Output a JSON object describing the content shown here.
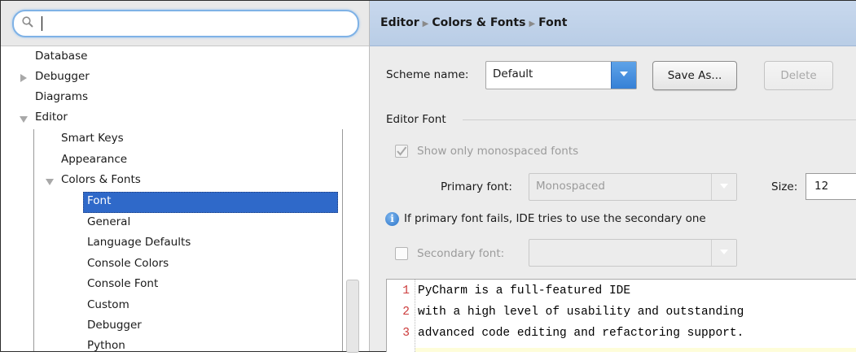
{
  "search": {
    "placeholder": "",
    "value": ""
  },
  "tree": {
    "items": [
      {
        "label": "Database",
        "level": 0,
        "expander": "none"
      },
      {
        "label": "Debugger",
        "level": 0,
        "expander": "collapsed"
      },
      {
        "label": "Diagrams",
        "level": 0,
        "expander": "none"
      },
      {
        "label": "Editor",
        "level": 0,
        "expander": "expanded"
      },
      {
        "label": "Smart Keys",
        "level": 1,
        "expander": "none"
      },
      {
        "label": "Appearance",
        "level": 1,
        "expander": "none"
      },
      {
        "label": "Colors & Fonts",
        "level": 1,
        "expander": "expanded"
      },
      {
        "label": "Font",
        "level": 2,
        "expander": "none",
        "selected": true
      },
      {
        "label": "General",
        "level": 2,
        "expander": "none"
      },
      {
        "label": "Language Defaults",
        "level": 2,
        "expander": "none"
      },
      {
        "label": "Console Colors",
        "level": 2,
        "expander": "none"
      },
      {
        "label": "Console Font",
        "level": 2,
        "expander": "none"
      },
      {
        "label": "Custom",
        "level": 2,
        "expander": "none"
      },
      {
        "label": "Debugger",
        "level": 2,
        "expander": "none"
      },
      {
        "label": "Python",
        "level": 2,
        "expander": "none"
      }
    ]
  },
  "breadcrumb": {
    "parts": [
      "Editor",
      "Colors & Fonts",
      "Font"
    ]
  },
  "scheme": {
    "label": "Scheme name:",
    "value": "Default",
    "save_as": "Save As...",
    "delete": "Delete"
  },
  "editor_font": {
    "section_title": "Editor Font",
    "monospaced_label": "Show only monospaced fonts",
    "monospaced_checked": true,
    "primary_label": "Primary font:",
    "primary_value": "Monospaced",
    "size_label": "Size:",
    "size_value": "12",
    "info_text": "If primary font fails, IDE tries to use the secondary one",
    "secondary_label": "Secondary font:",
    "secondary_value": "",
    "secondary_checked": false
  },
  "preview": {
    "lines": [
      {
        "no": "1",
        "text": "PyCharm is a full-featured IDE"
      },
      {
        "no": "2",
        "text": "with a high level of usability and outstanding"
      },
      {
        "no": "3",
        "text": "advanced code editing and refactoring support."
      }
    ]
  },
  "colors": {
    "selection": "#2f69c9",
    "accent": "#3680d6",
    "line_number": "#cc3b3b"
  }
}
